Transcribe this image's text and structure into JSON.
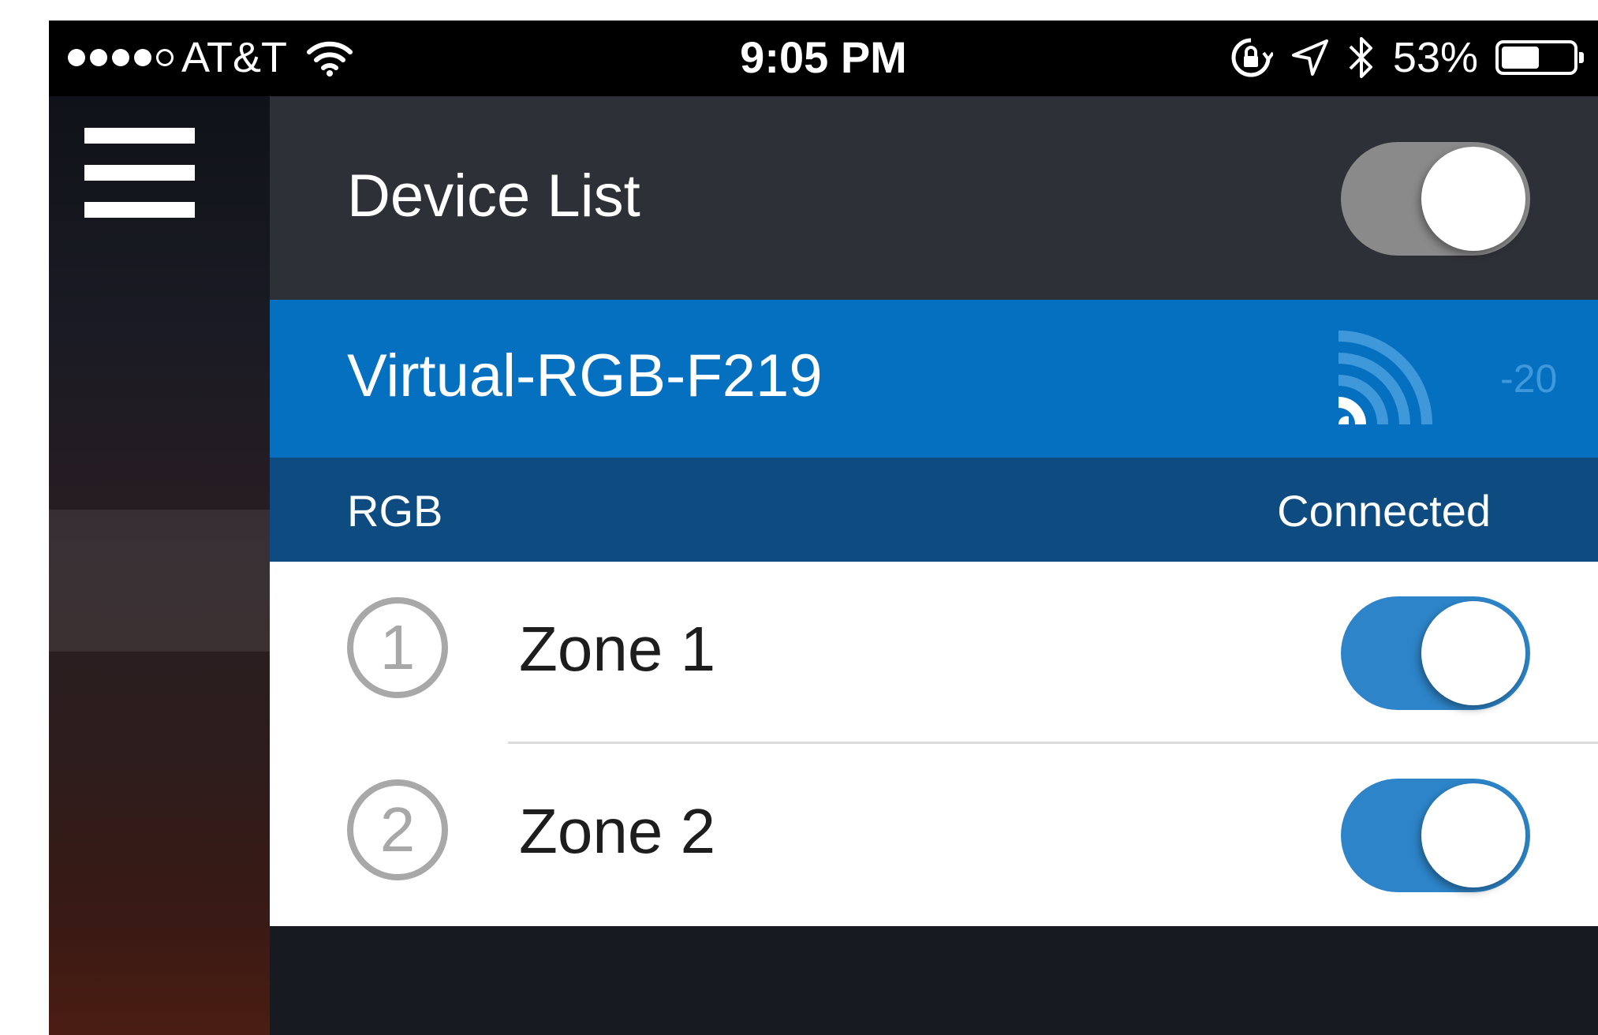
{
  "status_bar": {
    "carrier": "AT&T",
    "time": "9:05 PM",
    "battery_text": "53%",
    "battery_level": 0.53,
    "signal_bars_filled": 4,
    "signal_bars_total": 5,
    "icons": [
      "wifi-icon",
      "rotation-lock-icon",
      "location-icon",
      "bluetooth-icon",
      "battery-icon"
    ]
  },
  "nav": {
    "menu_icon": "hamburger-menu-icon"
  },
  "header": {
    "title": "Device List",
    "toggle_on": false
  },
  "device": {
    "name": "Virtual-RGB-F219",
    "signal_icon": "signal-strength-icon",
    "rssi": "-20",
    "type": "RGB",
    "status": "Connected"
  },
  "zones": [
    {
      "number": "1",
      "label": "Zone 1",
      "enabled": true
    },
    {
      "number": "2",
      "label": "Zone 2",
      "enabled": true
    }
  ],
  "colors": {
    "header_bg": "#2d3036",
    "device_row_bg": "#0570c0",
    "info_row_bg": "#0d4b80",
    "toggle_on": "#2d84c8",
    "toggle_off": "#8a8a8a"
  }
}
